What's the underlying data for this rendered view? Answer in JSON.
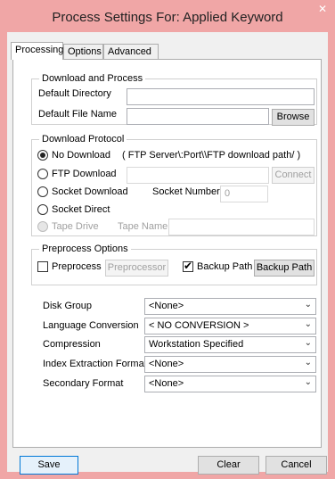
{
  "window": {
    "title": "Process Settings For: Applied Keyword",
    "close_icon": "✕"
  },
  "tabs": [
    {
      "label": "Processing",
      "active": true
    },
    {
      "label": "Options",
      "active": false
    },
    {
      "label": "Advanced",
      "active": false
    }
  ],
  "download_process": {
    "legend": "Download and Process",
    "default_directory_label": "Default Directory",
    "default_directory_value": "",
    "default_file_name_label": "Default File Name",
    "default_file_name_value": "",
    "browse_label": "Browse"
  },
  "download_protocol": {
    "legend": "Download Protocol",
    "no_download_label": "No Download",
    "no_download_hint": "( FTP Server\\:Port\\\\FTP download path/ )",
    "ftp_download_label": "FTP Download",
    "ftp_value": "",
    "connect_label": "Connect",
    "socket_download_label": "Socket Download",
    "socket_number_label": "Socket Number",
    "socket_number_value": "0",
    "socket_direct_label": "Socket Direct",
    "tape_drive_label": "Tape Drive",
    "tape_name_label": "Tape Name",
    "tape_name_value": "",
    "selected": "No Download"
  },
  "preprocess_options": {
    "legend": "Preprocess Options",
    "preprocess_label": "Preprocess",
    "preprocess_checked": false,
    "preprocessor_label": "Preprocessor",
    "backup_path_check_label": "Backup Path",
    "backup_path_checked": true,
    "backup_path_button_label": "Backup Path"
  },
  "settings": {
    "disk_group_label": "Disk Group",
    "disk_group_value": "<None>",
    "language_conversion_label": "Language Conversion",
    "language_conversion_value": "< NO CONVERSION >",
    "compression_label": "Compression",
    "compression_value": "Workstation Specified",
    "index_extraction_label": "Index Extraction Format",
    "index_extraction_value": "<None>",
    "secondary_format_label": "Secondary Format",
    "secondary_format_value": "<None>",
    "dropdown_arrow": "⌄"
  },
  "footer": {
    "save_label": "Save",
    "clear_label": "Clear",
    "cancel_label": "Cancel"
  }
}
